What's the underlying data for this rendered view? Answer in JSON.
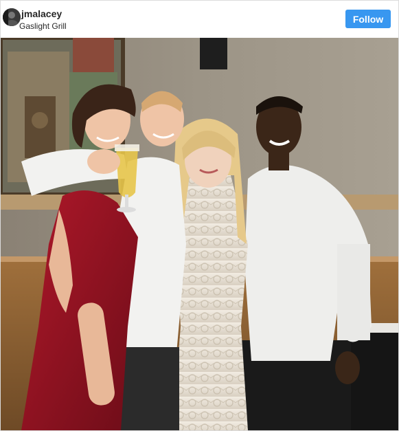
{
  "post": {
    "username": "jmalacey",
    "location": "Gaslight Grill",
    "follow_label": "Follow"
  },
  "colors": {
    "follow_button": "#3897f0",
    "border": "#dbdbdb",
    "text": "#262626"
  },
  "icons": {
    "avatar": "profile-avatar"
  }
}
